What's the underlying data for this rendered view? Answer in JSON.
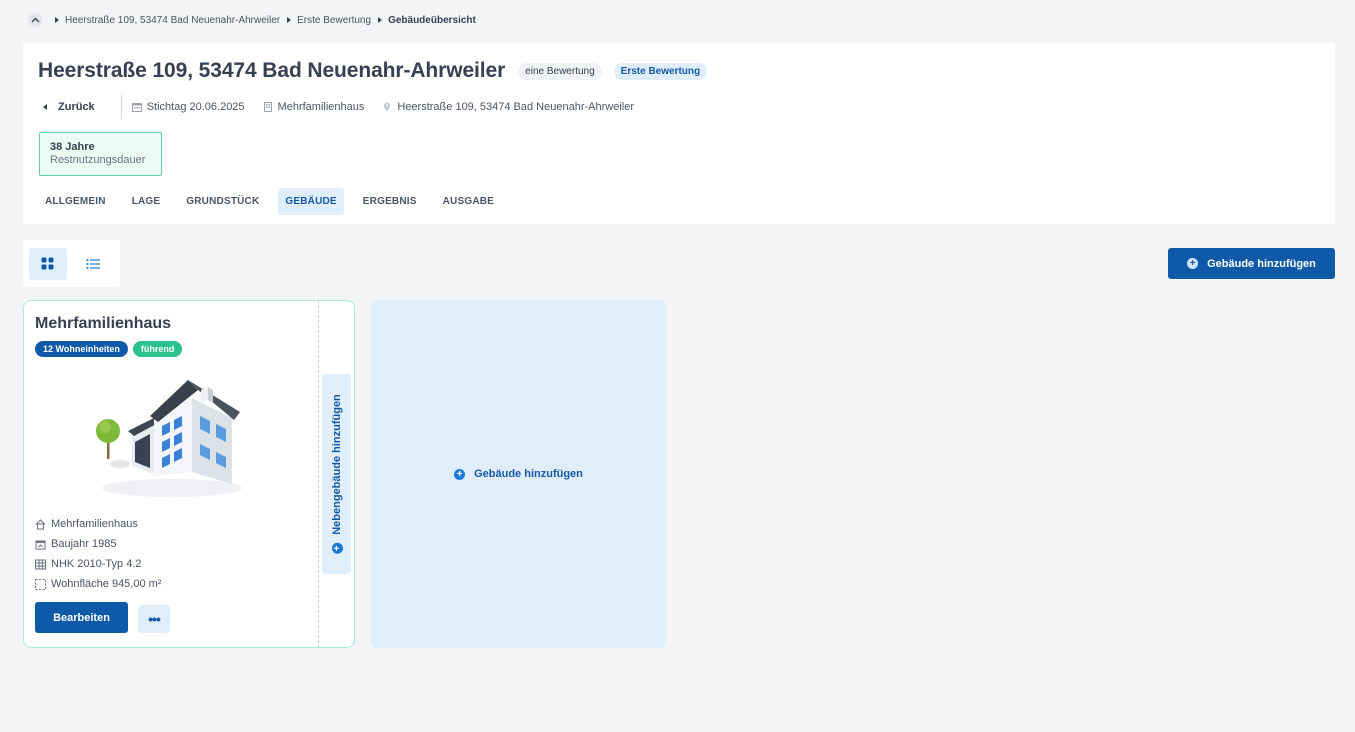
{
  "breadcrumb": {
    "items": [
      "Heerstraße 109, 53474 Bad Neuenahr-Ahrweiler",
      "Erste Bewertung",
      "Gebäudeübersicht"
    ]
  },
  "header": {
    "title": "Heerstraße 109, 53474 Bad Neuenahr-Ahrweiler",
    "pill_type": "eine Bewertung",
    "pill_status": "Erste Bewertung",
    "back_label": "Zurück",
    "stichtag": "Stichtag 20.06.2025",
    "building_type": "Mehrfamilienhaus",
    "address": "Heerstraße 109, 53474 Bad Neuenahr-Ahrweiler",
    "rnd_value": "38 Jahre",
    "rnd_label": "Restnutzungsdauer"
  },
  "tabs": [
    {
      "label": "ALLGEMEIN"
    },
    {
      "label": "LAGE"
    },
    {
      "label": "GRUNDSTÜCK"
    },
    {
      "label": "GEBÄUDE"
    },
    {
      "label": "ERGEBNIS"
    },
    {
      "label": "AUSGABE"
    }
  ],
  "active_tab": "GEBÄUDE",
  "toolbar": {
    "add_building_label": "Gebäude hinzufügen"
  },
  "building": {
    "title": "Mehrfamilienhaus",
    "badge_units": "12 Wohneinheiten",
    "badge_lead": "führend",
    "props": {
      "type": "Mehrfamilienhaus",
      "year": "Baujahr 1985",
      "nhk": "NHK 2010-Typ 4.2",
      "area": "Wohnfläche 945,00 m²"
    },
    "edit_label": "Bearbeiten",
    "more_label": "•••"
  },
  "side_panel": {
    "label": "Nebengebäude hinzufügen"
  },
  "add_panel": {
    "label": "Gebäude hinzufügen"
  },
  "colors": {
    "primary": "#0f5aa8",
    "accent_light": "#e0eefc",
    "success": "#2bc28d",
    "background": "#f3f4f6"
  }
}
